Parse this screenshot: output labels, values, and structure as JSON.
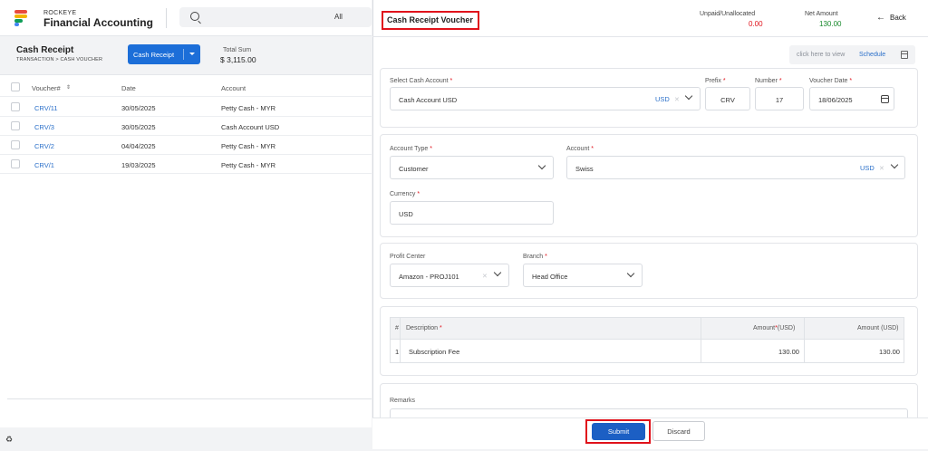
{
  "app": {
    "brand_small": "ROCKEYE",
    "brand_big": "Financial Accounting",
    "search_scope": "All"
  },
  "colors": {
    "accent": "#1c6ed8",
    "danger": "#e0121b",
    "success": "#1a8a2e",
    "link": "#2a6fc9"
  },
  "list_page": {
    "title": "Cash Receipt",
    "breadcrumb": "TRANSACTION  >  CASH VOUCHER",
    "action_button": "Cash Receipt",
    "total_sum_label": "Total Sum",
    "total_sum_value": "$ 3,115.00",
    "columns": [
      "Voucher#",
      "Date",
      "Account"
    ],
    "rows": [
      {
        "voucher": "CRV/11",
        "date": "30/05/2025",
        "account": "Petty Cash - MYR"
      },
      {
        "voucher": "CRV/3",
        "date": "30/05/2025",
        "account": "Cash Account USD"
      },
      {
        "voucher": "CRV/2",
        "date": "04/04/2025",
        "account": "Petty Cash - MYR"
      },
      {
        "voucher": "CRV/1",
        "date": "19/03/2025",
        "account": "Petty Cash - MYR"
      }
    ]
  },
  "drawer": {
    "title": "Cash Receipt Voucher",
    "unpaid_label": "Unpaid/Unallocated",
    "unpaid_value": "0.00",
    "net_amount_label": "Net Amount",
    "net_amount_value": "130.00",
    "back_label": "Back",
    "schedule_hint": "click here to view",
    "schedule_link": "Schedule",
    "cash_account": {
      "label": "Select Cash Account",
      "value": "Cash Account USD",
      "currency": "USD"
    },
    "prefix": {
      "label": "Prefix",
      "value": "CRV"
    },
    "number": {
      "label": "Number",
      "value": "17"
    },
    "voucher_date": {
      "label": "Voucher Date",
      "value": "18/06/2025"
    },
    "account_type": {
      "label": "Account Type",
      "value": "Customer"
    },
    "account": {
      "label": "Account",
      "value": "Swiss",
      "currency": "USD"
    },
    "currency": {
      "label": "Currency",
      "value": "USD"
    },
    "profit_center": {
      "label": "Profit Center",
      "value": "Amazon - PROJ101"
    },
    "branch": {
      "label": "Branch",
      "value": "Head Office"
    },
    "lines": {
      "headers": {
        "index": "#",
        "description": "Description",
        "amount_usd_req": "Amount",
        "amount_usd_req_suffix": "(USD)",
        "amount_usd": "Amount (USD)"
      },
      "rows": [
        {
          "index": "1",
          "description": "Subscription Fee",
          "amount": "130.00",
          "amount_usd": "130.00"
        }
      ]
    },
    "remarks_label": "Remarks",
    "submit_label": "Submit",
    "discard_label": "Discard",
    "required_mark": "*"
  }
}
